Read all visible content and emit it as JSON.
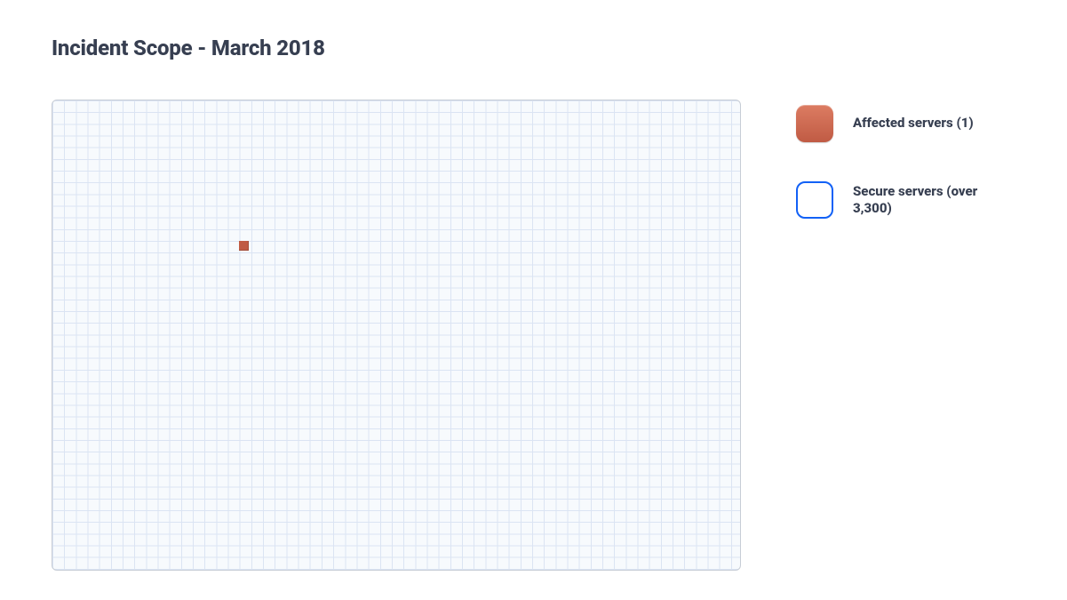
{
  "title": "Incident Scope - March 2018",
  "legend": {
    "affected": "Affected servers (1)",
    "secure": "Secure servers (over 3,300)"
  },
  "chart_data": {
    "type": "area",
    "title": "Incident Scope - March 2018",
    "series": [
      {
        "name": "Affected servers",
        "value": 1
      },
      {
        "name": "Secure servers",
        "value": 3300
      }
    ],
    "total_cells_approx": 2300,
    "highlighted_cells": 1
  }
}
